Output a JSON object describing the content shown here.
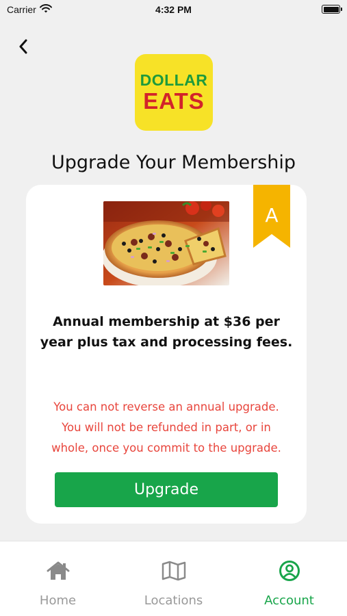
{
  "status_bar": {
    "carrier": "Carrier",
    "time": "4:32 PM",
    "wifi_icon": "wifi-icon",
    "battery_icon": "battery-icon"
  },
  "header": {
    "back_icon": "chevron-left-icon"
  },
  "logo": {
    "line1": "DOLLAR",
    "line2": "EATS",
    "colors": {
      "background": "#f7e227",
      "line1": "#1e9a3c",
      "line2": "#d2232a"
    }
  },
  "page": {
    "title": "Upgrade Your Membership"
  },
  "card": {
    "badge_letter": "A",
    "badge_color": "#f5b400",
    "image_subject": "pizza",
    "membership_description": "Annual membership at $36 per year plus tax and processing fees.",
    "warning_line1": "You can not reverse an annual upgrade.",
    "warning_line2": "You will not be refunded in part, or in",
    "warning_line3": "whole, once you commit to the upgrade.",
    "warning_color": "#e8453c",
    "upgrade_button_label": "Upgrade",
    "button_color": "#18a54a"
  },
  "tab_bar": {
    "items": [
      {
        "label": "Home",
        "icon": "home-icon",
        "active": false
      },
      {
        "label": "Locations",
        "icon": "map-icon",
        "active": false
      },
      {
        "label": "Account",
        "icon": "account-icon",
        "active": true
      }
    ],
    "active_color": "#18a54a",
    "inactive_color": "#999999"
  }
}
